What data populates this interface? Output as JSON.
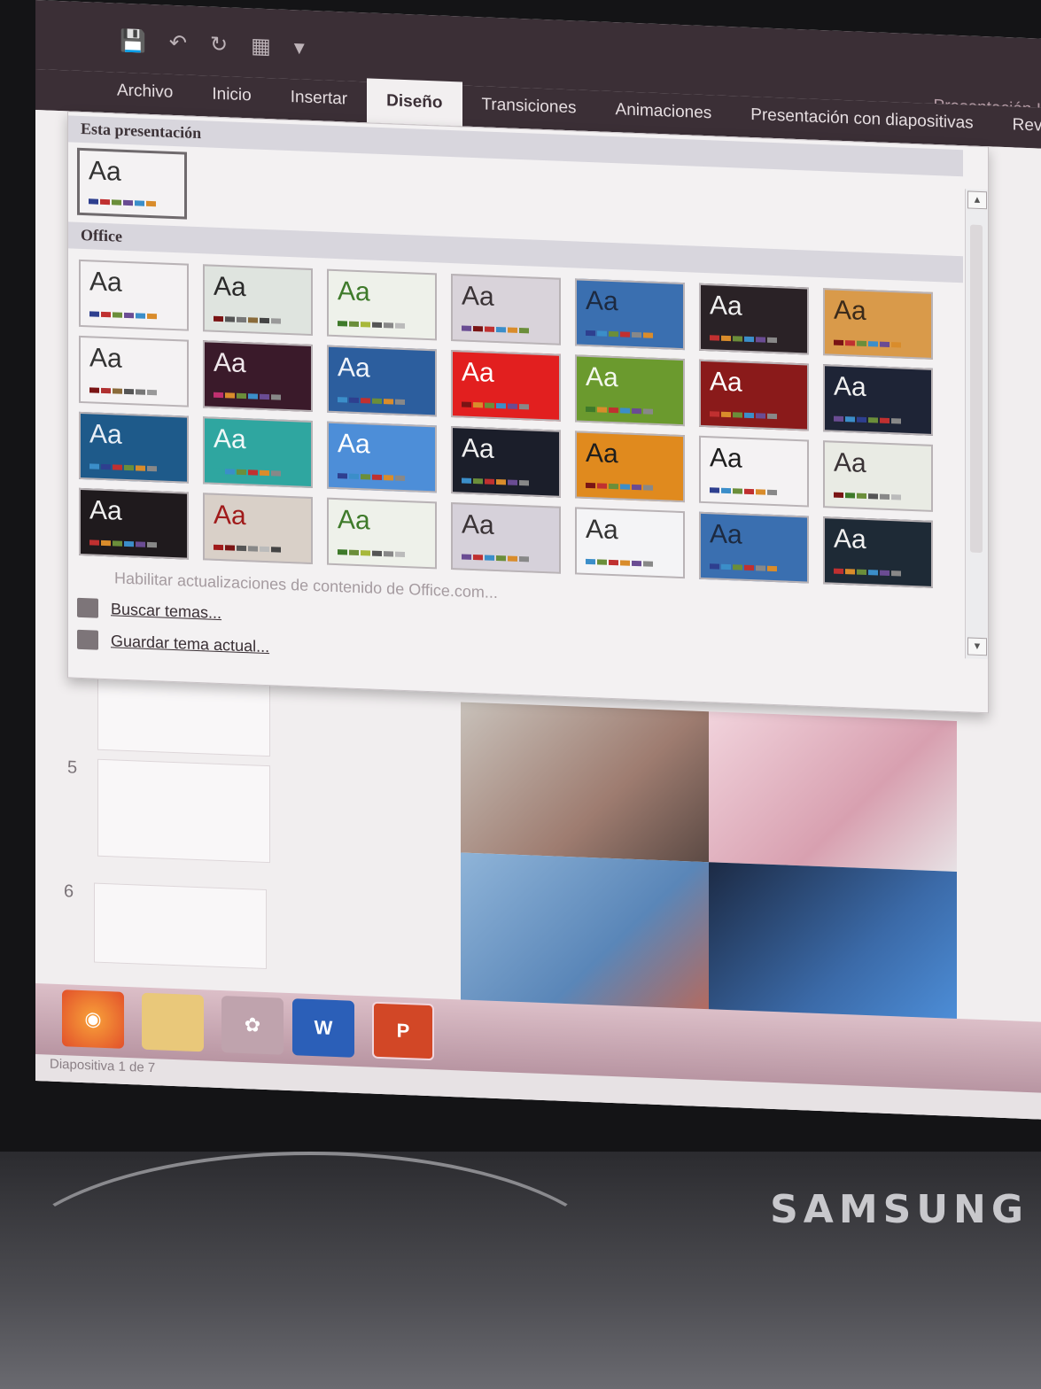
{
  "quick_access": {
    "save_icon": "save-icon",
    "undo_icon": "undo-icon",
    "redo_icon": "redo-icon",
    "present_icon": "present-icon",
    "more_icon": "customize-icon"
  },
  "app_title": "Presentación I",
  "tabs": [
    "Archivo",
    "Inicio",
    "Insertar",
    "Diseño",
    "Transiciones",
    "Animaciones",
    "Presentación con diapositivas",
    "Revisar"
  ],
  "active_tab": "Diseño",
  "gallery": {
    "section_this": "Esta presentación",
    "section_office": "Office",
    "theme_glyph": "Aa",
    "themes": [
      {
        "bg": "#f4f2f3",
        "fg": "#333",
        "bars": [
          "#2e3f8f",
          "#c03030",
          "#6b8e3a",
          "#6a4c93",
          "#3b8ec9",
          "#d98c2b"
        ]
      },
      {
        "bg": "#dfe4df",
        "fg": "#2a2a2a",
        "bars": [
          "#7a1414",
          "#555",
          "#777",
          "#8a6b3a",
          "#444",
          "#999"
        ]
      },
      {
        "bg": "#eef1ea",
        "fg": "#3e7a2a",
        "bars": [
          "#3e7a2a",
          "#6b8e3a",
          "#a8b83a",
          "#555",
          "#888",
          "#bbb"
        ]
      },
      {
        "bg": "#d9d3da",
        "fg": "#3a3336",
        "bars": [
          "#6a4c93",
          "#7a1414",
          "#c03030",
          "#3b8ec9",
          "#d98c2b",
          "#6b8e3a"
        ]
      },
      {
        "bg": "#3a6fb0",
        "fg": "#1d2a40",
        "bars": [
          "#2e3f8f",
          "#3b8ec9",
          "#6b8e3a",
          "#c03030",
          "#888",
          "#d98c2b"
        ]
      },
      {
        "bg": "#2a2226",
        "fg": "#f0f0f0",
        "bars": [
          "#c03030",
          "#d98c2b",
          "#6b8e3a",
          "#3b8ec9",
          "#6a4c93",
          "#888"
        ]
      },
      {
        "bg": "#d99a4a",
        "fg": "#3a2a1a",
        "bars": [
          "#7a1414",
          "#c03030",
          "#6b8e3a",
          "#3b8ec9",
          "#6a4c93",
          "#d98c2b"
        ]
      },
      {
        "bg": "#f4f2f3",
        "fg": "#333",
        "bars": [
          "#7a1414",
          "#b03030",
          "#8a6b3a",
          "#555",
          "#777",
          "#999"
        ]
      },
      {
        "bg": "#3a1a2a",
        "fg": "#f0e8ec",
        "bars": [
          "#c03070",
          "#d98c2b",
          "#6b8e3a",
          "#3b8ec9",
          "#6a4c93",
          "#888"
        ]
      },
      {
        "bg": "#2c5e9e",
        "fg": "#f0f4fa",
        "bars": [
          "#3b8ec9",
          "#2e3f8f",
          "#c03030",
          "#6b8e3a",
          "#d98c2b",
          "#888"
        ]
      },
      {
        "bg": "#e21f1f",
        "fg": "#ffffff",
        "bars": [
          "#7a1414",
          "#d98c2b",
          "#6b8e3a",
          "#3b8ec9",
          "#6a4c93",
          "#888"
        ]
      },
      {
        "bg": "#6b9a2e",
        "fg": "#f4f8ee",
        "bars": [
          "#3e7a2a",
          "#d98c2b",
          "#c03030",
          "#3b8ec9",
          "#6a4c93",
          "#888"
        ]
      },
      {
        "bg": "#8a1a1a",
        "fg": "#ffffff",
        "bars": [
          "#c03030",
          "#d98c2b",
          "#6b8e3a",
          "#3b8ec9",
          "#6a4c93",
          "#888"
        ]
      },
      {
        "bg": "#1e2436",
        "fg": "#f0f0f0",
        "bars": [
          "#6a4c93",
          "#3b8ec9",
          "#2e3f8f",
          "#6b8e3a",
          "#c03030",
          "#888"
        ]
      },
      {
        "bg": "#1e5a8a",
        "fg": "#e8eef6",
        "bars": [
          "#3b8ec9",
          "#2e3f8f",
          "#c03030",
          "#6b8e3a",
          "#d98c2b",
          "#888"
        ]
      },
      {
        "bg": "#2fa6a0",
        "fg": "#f0f8f8",
        "bars": [
          "#2fa6a0",
          "#3b8ec9",
          "#6b8e3a",
          "#c03030",
          "#d98c2b",
          "#888"
        ]
      },
      {
        "bg": "#4d8ed8",
        "fg": "#ffffff",
        "bars": [
          "#2e3f8f",
          "#3b8ec9",
          "#6b8e3a",
          "#c03030",
          "#d98c2b",
          "#888"
        ]
      },
      {
        "bg": "#1b1e2a",
        "fg": "#f0f0f0",
        "bars": [
          "#3b8ec9",
          "#6b8e3a",
          "#c03030",
          "#d98c2b",
          "#6a4c93",
          "#888"
        ]
      },
      {
        "bg": "#e08a1e",
        "fg": "#1d1d1d",
        "bars": [
          "#7a1414",
          "#c03030",
          "#6b8e3a",
          "#3b8ec9",
          "#6a4c93",
          "#888"
        ]
      },
      {
        "bg": "#f4f2f3",
        "fg": "#1d1d1d",
        "bars": [
          "#2e3f8f",
          "#3b8ec9",
          "#6b8e3a",
          "#c03030",
          "#d98c2b",
          "#888"
        ]
      },
      {
        "bg": "#e9ebe4",
        "fg": "#3a3336",
        "bars": [
          "#7a1414",
          "#3e7a2a",
          "#6b8e3a",
          "#555",
          "#888",
          "#bbb"
        ]
      },
      {
        "bg": "#1f1a1d",
        "fg": "#f0f0f0",
        "bars": [
          "#c03030",
          "#d98c2b",
          "#6b8e3a",
          "#3b8ec9",
          "#6a4c93",
          "#888"
        ]
      },
      {
        "bg": "#d9d0c8",
        "fg": "#a01a1a",
        "bars": [
          "#a01a1a",
          "#7a1414",
          "#555",
          "#888",
          "#bbb",
          "#444"
        ]
      },
      {
        "bg": "#eef1ea",
        "fg": "#3e7a2a",
        "bars": [
          "#3e7a2a",
          "#6b8e3a",
          "#a8b83a",
          "#555",
          "#888",
          "#bbb"
        ]
      },
      {
        "bg": "#d6d1da",
        "fg": "#3a3336",
        "bars": [
          "#6a4c93",
          "#c03030",
          "#3b8ec9",
          "#6b8e3a",
          "#d98c2b",
          "#888"
        ]
      },
      {
        "bg": "#f4f4f6",
        "fg": "#333",
        "bars": [
          "#3b8ec9",
          "#6b8e3a",
          "#c03030",
          "#d98c2b",
          "#6a4c93",
          "#888"
        ]
      },
      {
        "bg": "#3a6fb0",
        "fg": "#1d2a40",
        "bars": [
          "#2e3f8f",
          "#3b8ec9",
          "#6b8e3a",
          "#c03030",
          "#888",
          "#d98c2b"
        ]
      },
      {
        "bg": "#1e2a36",
        "fg": "#f0f0f0",
        "bars": [
          "#c03030",
          "#d98c2b",
          "#6b8e3a",
          "#3b8ec9",
          "#6a4c93",
          "#888"
        ]
      }
    ],
    "menu_disabled": "Habilitar actualizaciones de contenido de Office.com...",
    "menu_search": "Buscar temas...",
    "menu_save": "Guardar tema actual..."
  },
  "slides_pane": {
    "numbers": [
      "5",
      "6"
    ]
  },
  "status": "Diapositiva 1 de 7",
  "taskbar": [
    "firefox-icon",
    "file-explorer-icon",
    "media-icon",
    "W",
    "P"
  ],
  "brand": "SAMSUNG"
}
